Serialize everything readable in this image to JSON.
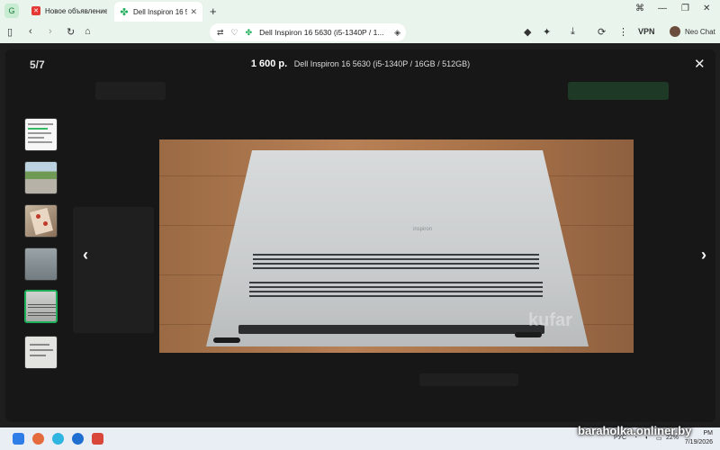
{
  "browser": {
    "tabs": [
      {
        "title": "Новое объявление - Б",
        "active": false
      },
      {
        "title": "Dell Inspiron 16 5630 (i5-",
        "active": true
      }
    ],
    "address": "Dell Inspiron 16 5630 (i5-1340P / 1...",
    "vpn_label": "VPN",
    "profile_name": "Neo Chat"
  },
  "gallery": {
    "counter": "5/7",
    "price": "1 600 р.",
    "title": "Dell Inspiron 16 5630 (i5-1340P / 16GB / 512GB)",
    "laptop_logo": "inspiron",
    "watermark": "kufar"
  },
  "taskbar": {
    "brand": "baraholka.onliner.by",
    "lang": "РУС",
    "battery": "22%",
    "time": "PM",
    "date": "7/19/2026"
  },
  "colors": {
    "accent": "#1fae5a",
    "browser_chrome": "#e9f4ec",
    "overlay": "#171717"
  }
}
